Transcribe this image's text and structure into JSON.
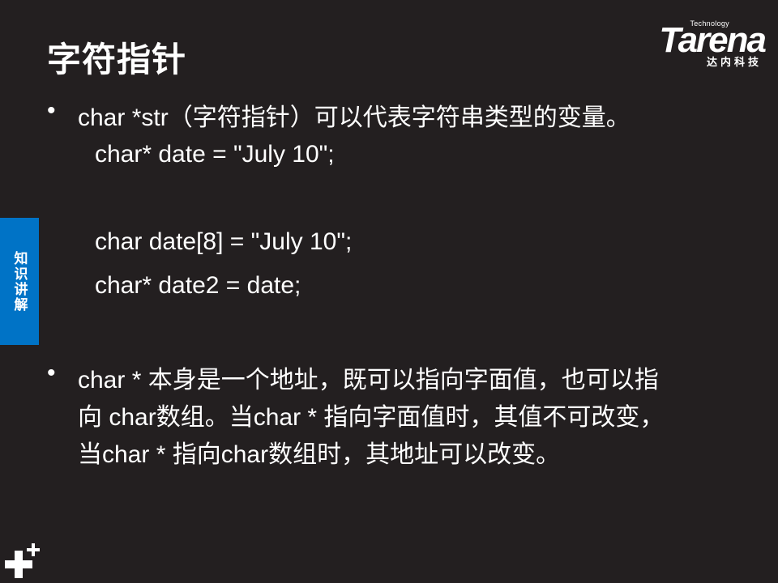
{
  "slide": {
    "title": "字符指针",
    "logo": {
      "tagline": "Technology",
      "wordmark": "Tarena",
      "subtitle": "达内科技"
    },
    "side_tab": "知识讲解",
    "bullets": [
      {
        "marker": "•",
        "lines": [
          "char *str（字符指针）可以代表字符串类型的变量。"
        ]
      },
      {
        "marker": "•",
        "lines": [
          "char * 本身是一个地址，既可以指向字面值，也可以指",
          "向 char数组。当char * 指向字面值时，其值不可改变，",
          "当char * 指向char数组时，其地址可以改变。"
        ]
      }
    ],
    "code_lines": [
      "char* date = \"July 10\";",
      "char date[8] = \"July 10\";",
      "char* date2 = date;"
    ],
    "colors": {
      "background": "#231f20",
      "accent": "#0073c6",
      "text": "#ffffff"
    }
  }
}
